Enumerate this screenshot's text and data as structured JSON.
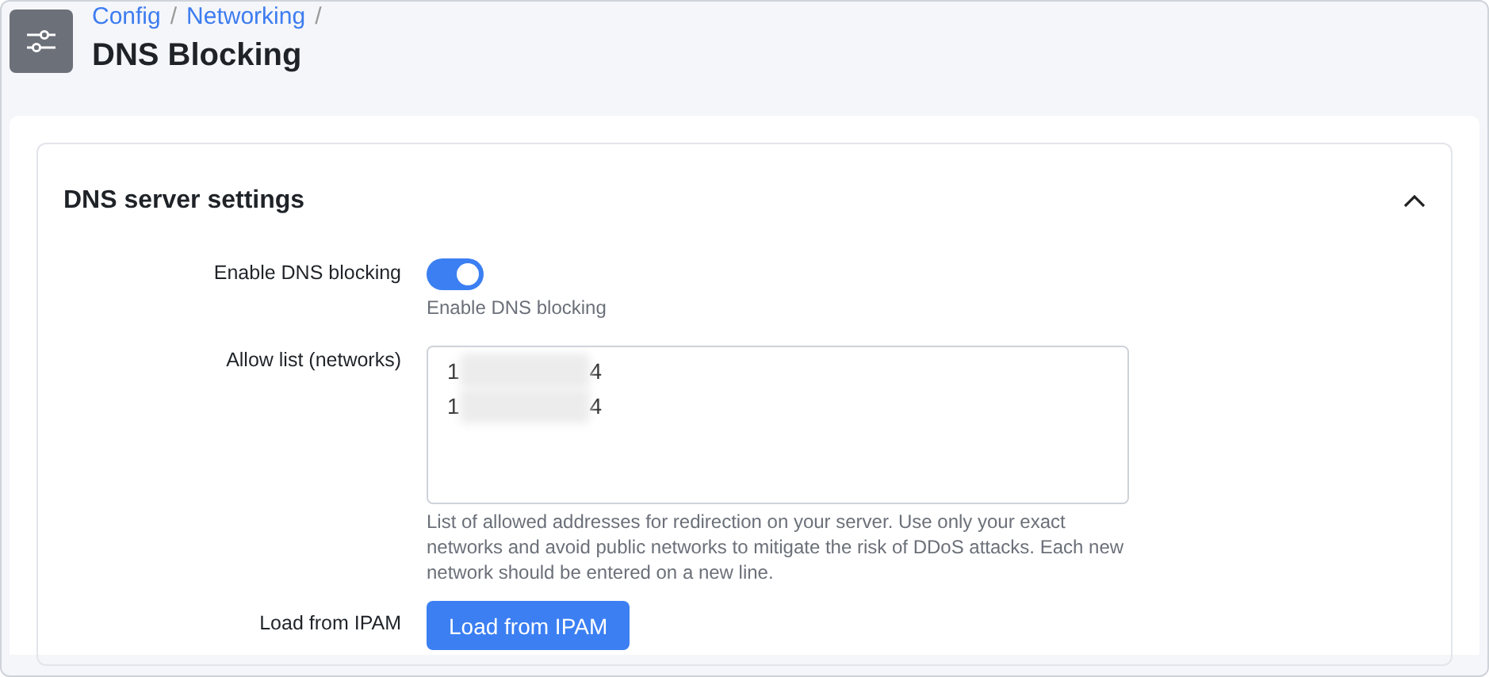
{
  "breadcrumb": [
    {
      "label": "Config"
    },
    {
      "label": "Networking"
    }
  ],
  "breadcrumb_separator": "/",
  "title": "DNS Blocking",
  "card": {
    "title": "DNS server settings",
    "expanded": true,
    "fields": [
      {
        "kind": "toggle",
        "label": "Enable DNS blocking",
        "on": true,
        "help": "Enable DNS blocking"
      },
      {
        "kind": "textarea",
        "label": "Allow list (networks)",
        "lines": [
          {
            "start": "1",
            "end": "4"
          },
          {
            "start": "1",
            "end": "4"
          }
        ],
        "help": "List of allowed addresses for redirection on your server. Use only your exact networks and avoid public networks to mitigate the risk of DDoS attacks. Each new network should be entered on a new line."
      },
      {
        "kind": "button",
        "label": "Load from IPAM",
        "button": "Load from IPAM"
      }
    ]
  }
}
